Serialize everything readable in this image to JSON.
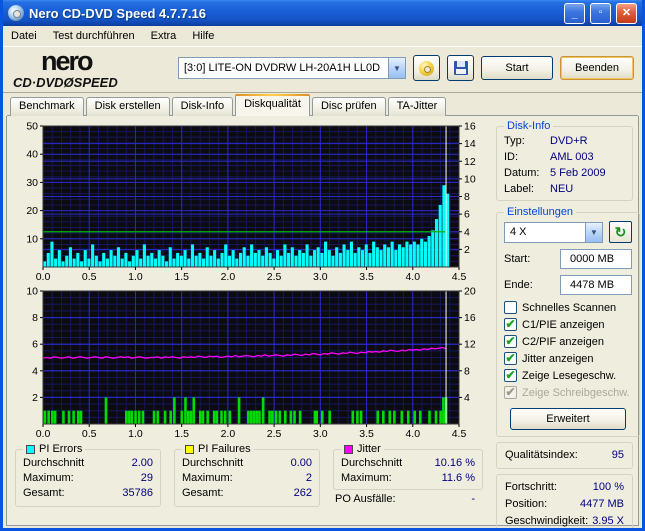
{
  "window": {
    "title": "Nero CD-DVD Speed 4.7.7.16"
  },
  "menu": {
    "items": [
      "Datei",
      "Test durchführen",
      "Extra",
      "Hilfe"
    ]
  },
  "header": {
    "logo_line1": "nero",
    "logo_line2": "CD·DVDØSPEED",
    "drive_select": "[3:0]   LITE-ON DVDRW LH-20A1H LL0D",
    "start_label": "Start",
    "quit_label": "Beenden"
  },
  "tabs": [
    {
      "label": "Benchmark",
      "active": false
    },
    {
      "label": "Disk erstellen",
      "active": false
    },
    {
      "label": "Disk-Info",
      "active": false
    },
    {
      "label": "Diskqualität",
      "active": true
    },
    {
      "label": "Disc prüfen",
      "active": false
    },
    {
      "label": "TA-Jitter",
      "active": false
    }
  ],
  "disk_info": {
    "title": "Disk-Info",
    "rows": [
      {
        "label": "Typ:",
        "value": "DVD+R"
      },
      {
        "label": "ID:",
        "value": "AML 003"
      },
      {
        "label": "Datum:",
        "value": "5 Feb 2009"
      },
      {
        "label": "Label:",
        "value": "NEU"
      }
    ]
  },
  "settings": {
    "title": "Einstellungen",
    "speed_value": "4 X",
    "start_label": "Start:",
    "start_value": "0000 MB",
    "end_label": "Ende:",
    "end_value": "4478 MB",
    "checkboxes": [
      {
        "label": "Schnelles Scannen",
        "checked": false,
        "disabled": false
      },
      {
        "label": "C1/PIE anzeigen",
        "checked": true,
        "disabled": false
      },
      {
        "label": "C2/PIF anzeigen",
        "checked": true,
        "disabled": false
      },
      {
        "label": "Jitter anzeigen",
        "checked": true,
        "disabled": false
      },
      {
        "label": "Zeige Lesegeschw.",
        "checked": true,
        "disabled": false
      },
      {
        "label": "Zeige Schreibgeschw.",
        "checked": true,
        "disabled": true
      }
    ],
    "advanced_label": "Erweitert"
  },
  "quality": {
    "label": "Qualitätsindex:",
    "value": "95"
  },
  "progress": {
    "rows": [
      {
        "label": "Fortschritt:",
        "value": "100 %"
      },
      {
        "label": "Position:",
        "value": "4477 MB"
      },
      {
        "label": "Geschwindigkeit:",
        "value": "3.95 X"
      }
    ]
  },
  "stats": {
    "pi_errors": {
      "title": "PI Errors",
      "legend_color": "#00FFFF",
      "rows": [
        [
          "Durchschnitt",
          "2.00"
        ],
        [
          "Maximum:",
          "29"
        ],
        [
          "Gesamt:",
          "35786"
        ]
      ]
    },
    "pi_failures": {
      "title": "PI Failures",
      "legend_color": "#FFFF00",
      "rows": [
        [
          "Durchschnitt",
          "0.00"
        ],
        [
          "Maximum:",
          "2"
        ],
        [
          "Gesamt:",
          "262"
        ]
      ]
    },
    "jitter": {
      "title": "Jitter",
      "legend_color": "#FF00FF",
      "rows": [
        [
          "Durchschnitt",
          "10.16 %"
        ],
        [
          "Maximum:",
          "11.6 %"
        ]
      ]
    },
    "po_failures": {
      "label": "PO Ausfälle:",
      "value": "-"
    }
  },
  "chart_data": [
    {
      "type": "bar",
      "title": "PI Errors and read speed vs position (GB)",
      "x_range": [
        0,
        4.5
      ],
      "x_major": 0.5,
      "x_minor": 0.1,
      "x_tick_labels": [
        "0.0",
        "0.5",
        "1.0",
        "1.5",
        "2.0",
        "2.5",
        "3.0",
        "3.5",
        "4.0",
        "4.5"
      ],
      "left_axis": {
        "range": [
          0,
          50
        ],
        "ticks": [
          10,
          20,
          30,
          40,
          50
        ],
        "minor_step": 2
      },
      "right_axis": {
        "range": [
          0,
          16
        ],
        "ticks": [
          2,
          4,
          6,
          8,
          10,
          12,
          14,
          16
        ]
      },
      "bg_color": "#0B0B10",
      "grid_major_color": "#2A2AC8",
      "grid_minor_color": "#17175E",
      "series": [
        {
          "name": "PI Errors",
          "type": "bars",
          "axis": "left",
          "color": "#00FFFF",
          "x_start": 0.0,
          "x_step": 0.04,
          "values": [
            2,
            5,
            9,
            3,
            6,
            2,
            4,
            7,
            3,
            5,
            2,
            6,
            3,
            8,
            4,
            2,
            5,
            3,
            6,
            4,
            7,
            3,
            5,
            2,
            4,
            6,
            3,
            8,
            4,
            5,
            3,
            6,
            4,
            2,
            7,
            3,
            5,
            4,
            6,
            3,
            8,
            4,
            5,
            3,
            7,
            4,
            6,
            3,
            5,
            8,
            4,
            6,
            3,
            5,
            7,
            4,
            8,
            5,
            6,
            4,
            7,
            5,
            3,
            6,
            4,
            8,
            5,
            7,
            4,
            6,
            5,
            8,
            4,
            6,
            7,
            5,
            9,
            6,
            4,
            7,
            5,
            8,
            6,
            9,
            5,
            7,
            6,
            8,
            5,
            9,
            7,
            6,
            8,
            7,
            9,
            6,
            8,
            7,
            9,
            8,
            9,
            8,
            10,
            9,
            11,
            13,
            17,
            22,
            29,
            26
          ]
        },
        {
          "name": "Lesegeschwindigkeit",
          "type": "line",
          "axis": "right",
          "color": "#00B400",
          "points": [
            [
              0,
              4
            ],
            [
              4.36,
              4
            ]
          ]
        },
        {
          "name": "position-cursor",
          "type": "vline",
          "color": "#FFFFFF",
          "x": 4.36
        }
      ]
    },
    {
      "type": "bar",
      "title": "PI Failures and Jitter vs position (GB)",
      "x_range": [
        0,
        4.5
      ],
      "x_major": 0.5,
      "x_minor": 0.1,
      "x_tick_labels": [
        "0.0",
        "0.5",
        "1.0",
        "1.5",
        "2.0",
        "2.5",
        "3.0",
        "3.5",
        "4.0",
        "4.5"
      ],
      "left_axis": {
        "range": [
          0,
          10
        ],
        "ticks": [
          2,
          4,
          6,
          8,
          10
        ],
        "minor_step": 0.5
      },
      "right_axis": {
        "range": [
          0,
          20
        ],
        "ticks": [
          4,
          8,
          12,
          16,
          20
        ]
      },
      "bg_color": "#0B0B10",
      "grid_major_color": "#2A2AC8",
      "grid_minor_color": "#17175E",
      "series": [
        {
          "name": "PI Failures",
          "type": "bars_list",
          "axis": "left",
          "color": "#00DC00",
          "bars": [
            [
              0.02,
              1
            ],
            [
              0.06,
              1
            ],
            [
              0.1,
              1
            ],
            [
              0.13,
              1
            ],
            [
              0.22,
              1
            ],
            [
              0.28,
              1
            ],
            [
              0.33,
              1
            ],
            [
              0.38,
              1
            ],
            [
              0.41,
              1
            ],
            [
              0.68,
              2
            ],
            [
              0.9,
              1
            ],
            [
              0.93,
              1
            ],
            [
              0.96,
              1
            ],
            [
              1.0,
              1
            ],
            [
              1.04,
              1
            ],
            [
              1.08,
              1
            ],
            [
              1.2,
              1
            ],
            [
              1.24,
              1
            ],
            [
              1.32,
              1
            ],
            [
              1.38,
              1
            ],
            [
              1.42,
              2
            ],
            [
              1.5,
              1
            ],
            [
              1.54,
              2
            ],
            [
              1.57,
              1
            ],
            [
              1.6,
              1
            ],
            [
              1.63,
              2
            ],
            [
              1.7,
              1
            ],
            [
              1.73,
              1
            ],
            [
              1.78,
              1
            ],
            [
              1.85,
              1
            ],
            [
              1.88,
              1
            ],
            [
              1.93,
              1
            ],
            [
              1.97,
              1
            ],
            [
              2.02,
              1
            ],
            [
              2.12,
              2
            ],
            [
              2.22,
              1
            ],
            [
              2.25,
              1
            ],
            [
              2.28,
              1
            ],
            [
              2.31,
              1
            ],
            [
              2.34,
              1
            ],
            [
              2.38,
              2
            ],
            [
              2.45,
              1
            ],
            [
              2.48,
              1
            ],
            [
              2.52,
              1
            ],
            [
              2.56,
              1
            ],
            [
              2.62,
              1
            ],
            [
              2.68,
              1
            ],
            [
              2.72,
              1
            ],
            [
              2.78,
              1
            ],
            [
              2.94,
              1
            ],
            [
              2.96,
              1
            ],
            [
              3.02,
              1
            ],
            [
              3.1,
              1
            ],
            [
              3.35,
              1
            ],
            [
              3.4,
              1
            ],
            [
              3.44,
              1
            ],
            [
              3.62,
              1
            ],
            [
              3.68,
              1
            ],
            [
              3.75,
              1
            ],
            [
              3.8,
              1
            ],
            [
              3.88,
              1
            ],
            [
              3.95,
              1
            ],
            [
              4.02,
              1
            ],
            [
              4.08,
              1
            ],
            [
              4.18,
              1
            ],
            [
              4.25,
              1
            ],
            [
              4.3,
              1
            ],
            [
              4.33,
              2
            ],
            [
              4.35,
              1
            ],
            [
              4.36,
              2
            ]
          ]
        },
        {
          "name": "Jitter",
          "type": "line",
          "axis": "right",
          "color": "#FF00FF",
          "x_start": 0.0,
          "x_step": 0.04,
          "values": [
            9.9,
            10.0,
            9.9,
            10.1,
            10.0,
            9.9,
            10.0,
            10.1,
            9.9,
            10.0,
            10.1,
            10.0,
            9.9,
            10.0,
            10.1,
            10.0,
            9.9,
            10.1,
            10.0,
            9.9,
            10.0,
            10.1,
            10.0,
            10.1,
            9.9,
            10.0,
            10.1,
            10.0,
            9.9,
            10.0,
            10.0,
            10.1,
            9.9,
            10.1,
            10.0,
            10.1,
            10.0,
            9.9,
            10.1,
            10.0,
            10.1,
            10.0,
            10.2,
            10.1,
            10.0,
            10.2,
            10.1,
            10.2,
            10.0,
            10.1,
            10.2,
            10.1,
            10.3,
            10.1,
            10.2,
            10.3,
            10.2,
            10.1,
            10.3,
            10.2,
            10.4,
            10.2,
            10.3,
            10.4,
            10.3,
            10.2,
            10.4,
            10.3,
            10.5,
            10.4,
            10.3,
            10.5,
            10.4,
            10.6,
            10.5,
            10.4,
            10.6,
            10.5,
            10.7,
            10.6,
            10.5,
            10.7,
            10.6,
            10.8,
            10.7,
            10.6,
            10.8,
            10.7,
            10.9,
            10.8,
            10.9,
            10.8,
            11.0,
            10.9,
            11.1,
            11.0,
            10.9,
            11.1,
            11.0,
            11.2,
            11.1,
            11.2,
            11.1,
            11.3,
            11.2,
            11.4,
            11.3,
            11.4,
            11.5,
            11.3
          ]
        },
        {
          "name": "position-cursor",
          "type": "vline",
          "color": "#FFFFFF",
          "x": 4.36
        }
      ]
    }
  ]
}
